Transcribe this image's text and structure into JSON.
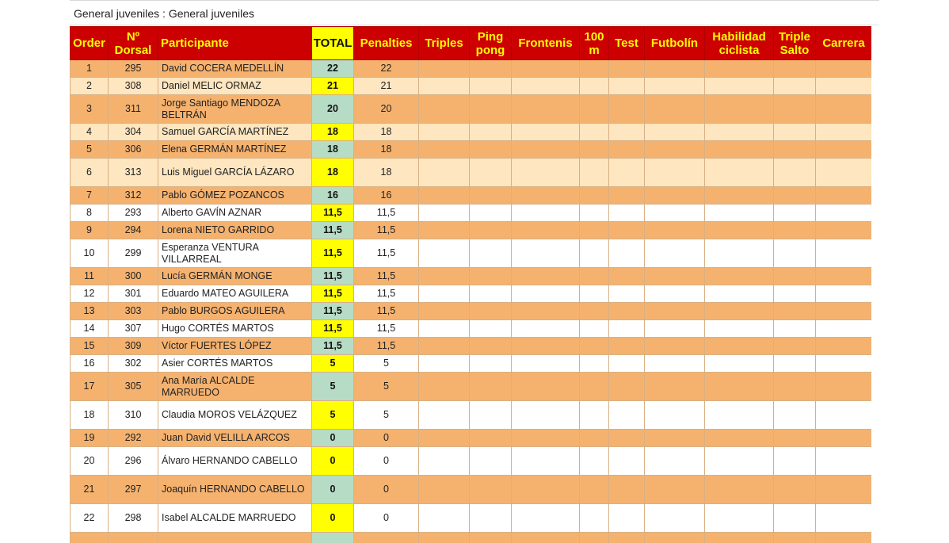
{
  "page": {
    "title": "General juveniles : General juveniles"
  },
  "colors": {
    "header_bg": "#cc0000",
    "header_text": "#ffff00",
    "total_header_bg": "#ffff00",
    "row_orange": "#f5b26f",
    "row_light": "#fde6c0",
    "row_white": "#ffffff",
    "total_green": "#b6dcc5",
    "total_yellow": "#ffff00"
  },
  "table": {
    "headers": [
      "Order",
      "Nº Dorsal",
      "Participante",
      "TOTAL",
      "Penalties",
      "Triples",
      "Ping pong",
      "Frontenis",
      "100 m",
      "Test",
      "Futbolín",
      "Habilidad ciclista",
      "Triple Salto",
      "Carrera"
    ],
    "rows": [
      {
        "order": "1",
        "dorsal": "295",
        "name": "David COCERA MEDELLÍN",
        "total": "22",
        "penalties": "22",
        "style": "orange",
        "total_style": "green"
      },
      {
        "order": "2",
        "dorsal": "308",
        "name": "Daniel MELIC ORMAZ",
        "total": "21",
        "penalties": "21",
        "style": "light",
        "total_style": "yellow"
      },
      {
        "order": "3",
        "dorsal": "311",
        "name": "Jorge Santiago MENDOZA BELTRÁN",
        "total": "20",
        "penalties": "20",
        "style": "orange",
        "total_style": "green"
      },
      {
        "order": "4",
        "dorsal": "304",
        "name": "Samuel GARCÍA MARTÍNEZ",
        "total": "18",
        "penalties": "18",
        "style": "light",
        "total_style": "yellow"
      },
      {
        "order": "5",
        "dorsal": "306",
        "name": "Elena GERMÁN MARTÍNEZ",
        "total": "18",
        "penalties": "18",
        "style": "orange",
        "total_style": "green"
      },
      {
        "order": "6",
        "dorsal": "313",
        "name": "Luis Miguel GARCÍA LÁZARO",
        "total": "18",
        "penalties": "18",
        "style": "light",
        "total_style": "yellow"
      },
      {
        "order": "7",
        "dorsal": "312",
        "name": "Pablo GÓMEZ POZANCOS",
        "total": "16",
        "penalties": "16",
        "style": "orange",
        "total_style": "green"
      },
      {
        "order": "8",
        "dorsal": "293",
        "name": "Alberto GAVÍN AZNAR",
        "total": "11,5",
        "penalties": "11,5",
        "style": "white",
        "total_style": "yellow"
      },
      {
        "order": "9",
        "dorsal": "294",
        "name": "Lorena NIETO GARRIDO",
        "total": "11,5",
        "penalties": "11,5",
        "style": "orange",
        "total_style": "green"
      },
      {
        "order": "10",
        "dorsal": "299",
        "name": "Esperanza VENTURA VILLARREAL",
        "total": "11,5",
        "penalties": "11,5",
        "style": "white",
        "total_style": "yellow"
      },
      {
        "order": "11",
        "dorsal": "300",
        "name": "Lucía GERMÁN MONGE",
        "total": "11,5",
        "penalties": "11,5",
        "style": "orange",
        "total_style": "green"
      },
      {
        "order": "12",
        "dorsal": "301",
        "name": "Eduardo MATEO AGUILERA",
        "total": "11,5",
        "penalties": "11,5",
        "style": "white",
        "total_style": "yellow"
      },
      {
        "order": "13",
        "dorsal": "303",
        "name": "Pablo BURGOS AGUILERA",
        "total": "11,5",
        "penalties": "11,5",
        "style": "orange",
        "total_style": "green"
      },
      {
        "order": "14",
        "dorsal": "307",
        "name": "Hugo CORTÉS MARTOS",
        "total": "11,5",
        "penalties": "11,5",
        "style": "white",
        "total_style": "yellow"
      },
      {
        "order": "15",
        "dorsal": "309",
        "name": "Víctor FUERTES LÓPEZ",
        "total": "11,5",
        "penalties": "11,5",
        "style": "orange",
        "total_style": "green"
      },
      {
        "order": "16",
        "dorsal": "302",
        "name": "Asier CORTÉS MARTOS",
        "total": "5",
        "penalties": "5",
        "style": "white",
        "total_style": "yellow"
      },
      {
        "order": "17",
        "dorsal": "305",
        "name": "Ana María ALCALDE MARRUEDO",
        "total": "5",
        "penalties": "5",
        "style": "orange",
        "total_style": "green"
      },
      {
        "order": "18",
        "dorsal": "310",
        "name": "Claudia MOROS VELÁZQUEZ",
        "total": "5",
        "penalties": "5",
        "style": "white",
        "total_style": "yellow"
      },
      {
        "order": "19",
        "dorsal": "292",
        "name": "Juan David VELILLA ARCOS",
        "total": "0",
        "penalties": "0",
        "style": "orange",
        "total_style": "green"
      },
      {
        "order": "20",
        "dorsal": "296",
        "name": "Álvaro HERNANDO CABELLO",
        "total": "0",
        "penalties": "0",
        "style": "white",
        "total_style": "yellow"
      },
      {
        "order": "21",
        "dorsal": "297",
        "name": "Joaquín HERNANDO CABELLO",
        "total": "0",
        "penalties": "0",
        "style": "orange",
        "total_style": "green"
      },
      {
        "order": "22",
        "dorsal": "298",
        "name": "Isabel ALCALDE MARRUEDO",
        "total": "0",
        "penalties": "0",
        "style": "white",
        "total_style": "yellow"
      },
      {
        "order": "",
        "dorsal": "",
        "name": "",
        "total": "",
        "penalties": "",
        "style": "orange",
        "total_style": "green"
      }
    ]
  }
}
